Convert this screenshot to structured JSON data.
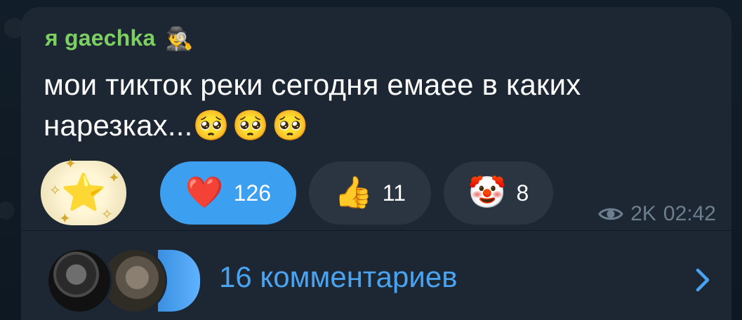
{
  "post": {
    "author": "я gaechka",
    "author_emoji": "🕵️‍♂️",
    "text_line1": "мои тикток реки сегодня емаее в каких",
    "text_line2": "нарезках...",
    "text_emojis": "🥺🥺🥺"
  },
  "reactions": [
    {
      "icon": "⭐",
      "icon_name": "star-icon",
      "count": ""
    },
    {
      "icon": "❤️",
      "icon_name": "heart-icon",
      "count": "126"
    },
    {
      "icon": "👍",
      "icon_name": "thumbs-up-icon",
      "count": "11"
    },
    {
      "icon": "🤡",
      "icon_name": "clown-icon",
      "count": "8"
    }
  ],
  "meta": {
    "views": "2K",
    "time": "02:42"
  },
  "comments": {
    "label": "16 комментариев"
  },
  "colors": {
    "background": "#0f1a24",
    "bubble": "#1c2733",
    "author": "#7ccf61",
    "accent": "#4aa3f0",
    "active_reaction": "#3c9ff0",
    "meta": "#6d7f8f"
  }
}
